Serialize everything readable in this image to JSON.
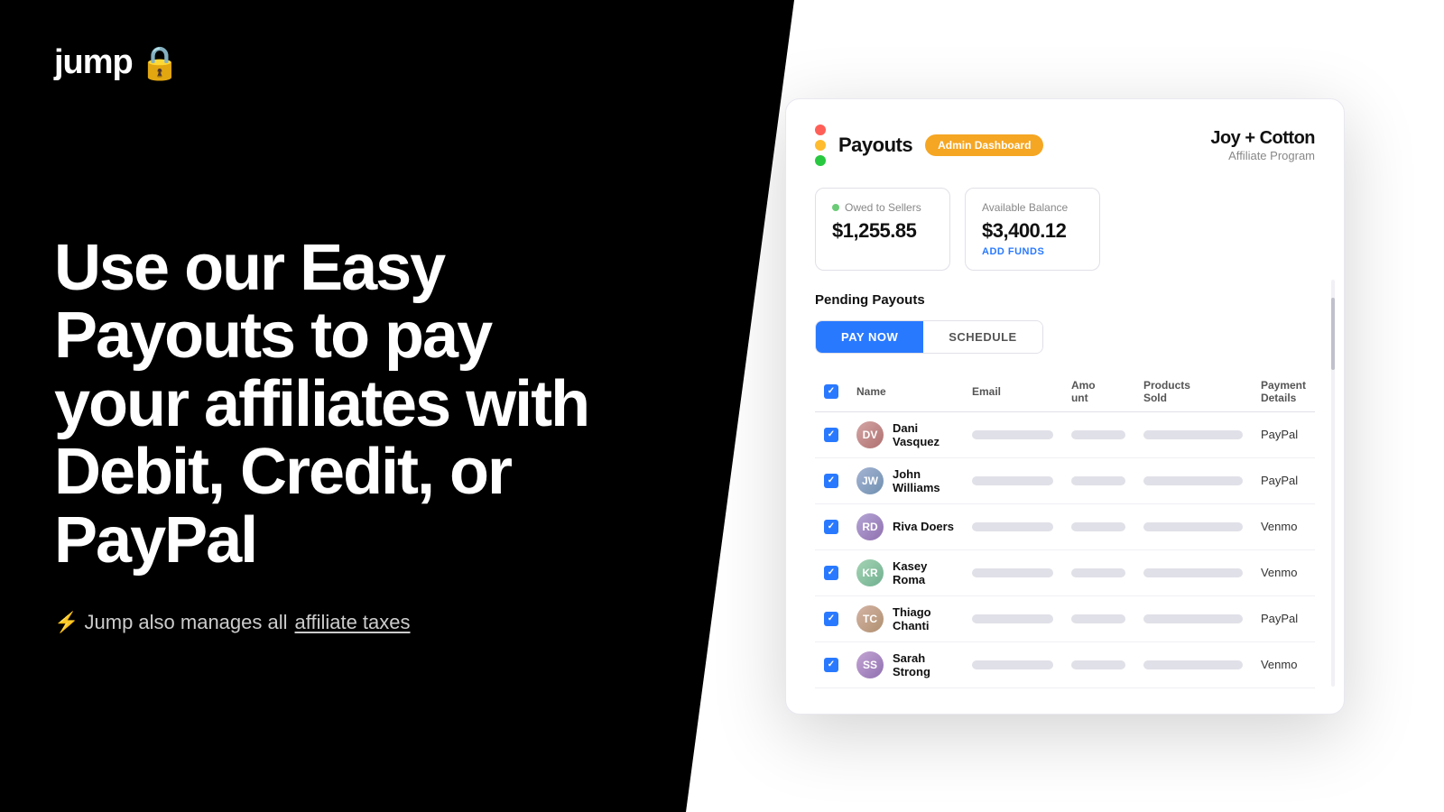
{
  "logo": {
    "text": "jump",
    "icon": "🔒"
  },
  "hero": {
    "headline": "Use our Easy Payouts to  pay your affiliates with Debit, Credit, or PayPal",
    "tagline_prefix": "⚡ Jump also manages all ",
    "tagline_link": "affiliate taxes"
  },
  "dashboard": {
    "title": "Payouts",
    "admin_badge": "Admin Dashboard",
    "brand_name": "Joy + Cotton",
    "brand_sub": "Affiliate Program",
    "stats": {
      "owed_label": "Owed to Sellers",
      "owed_value": "$1,255.85",
      "balance_label": "Available Balance",
      "balance_value": "$3,400.12",
      "add_funds": "ADD FUNDS"
    },
    "pending_title": "Pending Payouts",
    "tabs": [
      {
        "label": "PAY NOW",
        "active": true
      },
      {
        "label": "SCHEDULE",
        "active": false
      }
    ],
    "table": {
      "headers": [
        "",
        "Name",
        "Email",
        "Amount",
        "Products Sold",
        "Payment Details"
      ],
      "rows": [
        {
          "name": "Dani Vasquez",
          "avatar_class": "avatar-1",
          "initials": "DV",
          "payment": "PayPal"
        },
        {
          "name": "John Williams",
          "avatar_class": "avatar-2",
          "initials": "JW",
          "payment": "PayPal"
        },
        {
          "name": "Riva Doers",
          "avatar_class": "avatar-3",
          "initials": "RD",
          "payment": "Venmo"
        },
        {
          "name": "Kasey Roma",
          "avatar_class": "avatar-4",
          "initials": "KR",
          "payment": "Venmo"
        },
        {
          "name": "Thiago Chanti",
          "avatar_class": "avatar-5",
          "initials": "TC",
          "payment": "PayPal"
        },
        {
          "name": "Sarah Strong",
          "avatar_class": "avatar-6",
          "initials": "SS",
          "payment": "Venmo"
        }
      ]
    }
  }
}
